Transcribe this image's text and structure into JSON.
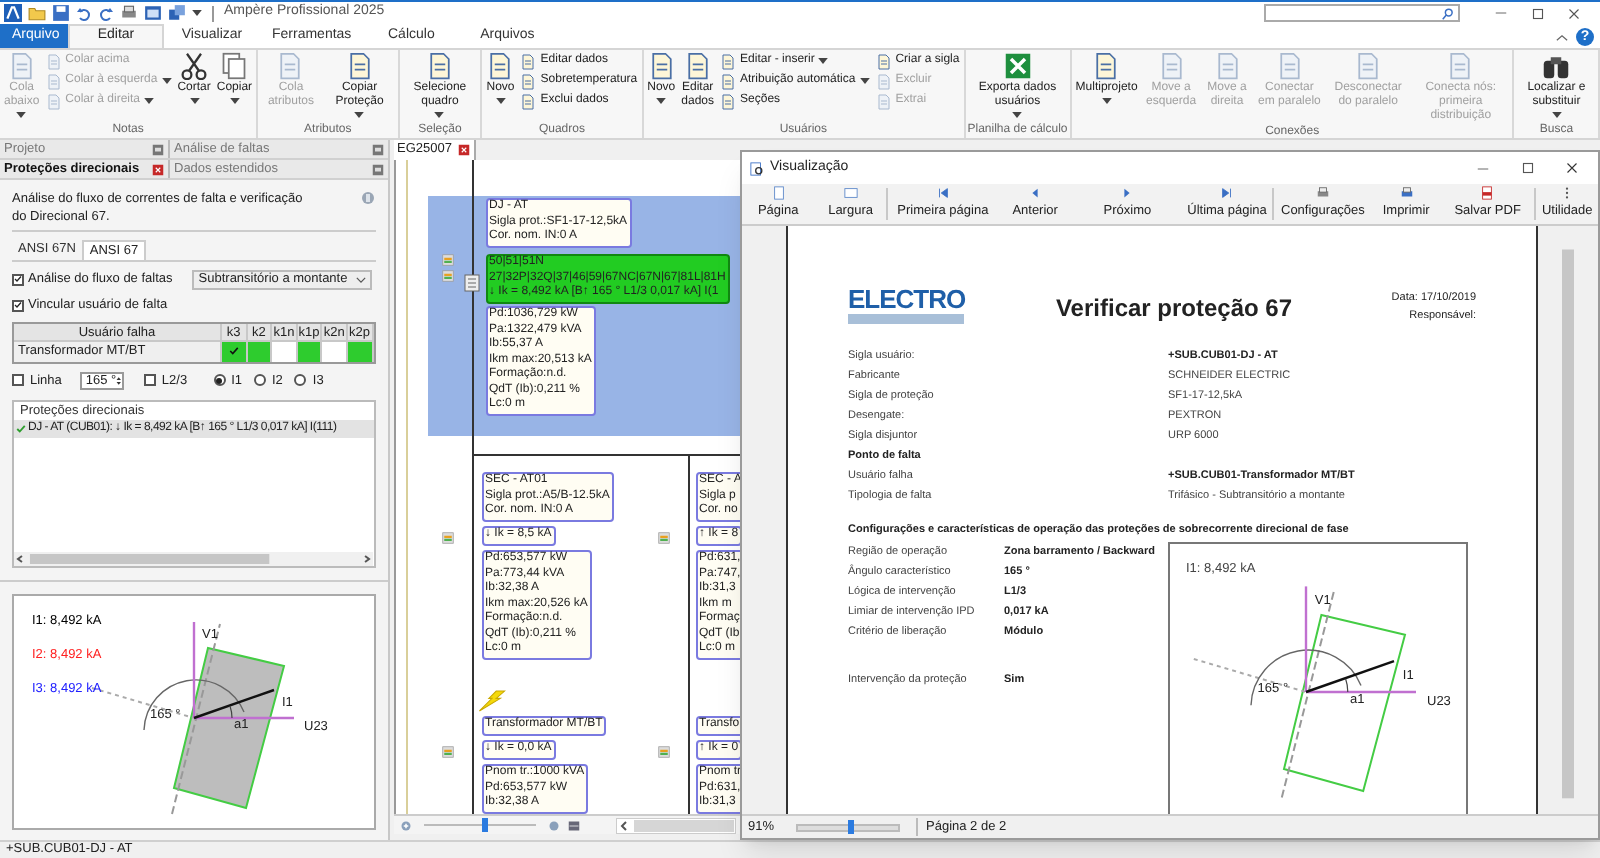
{
  "app": {
    "title": "Ampère Profissional 2025",
    "help": "?"
  },
  "ribbon_tabs": [
    {
      "label": "Arquivo",
      "kind": "file",
      "selected": false
    },
    {
      "label": "Editar",
      "kind": "tab",
      "selected": true
    },
    {
      "label": "Visualizar",
      "kind": "tab",
      "selected": false
    },
    {
      "label": "Ferramentas",
      "kind": "tab",
      "selected": false
    },
    {
      "label": "Cálculo",
      "kind": "tab",
      "selected": false
    },
    {
      "label": "Arquivos",
      "kind": "tab",
      "selected": false
    }
  ],
  "ribbon_groups": [
    {
      "label": "Notas",
      "items": [
        {
          "kind": "large",
          "label": "Cola abaixo",
          "disabled": true,
          "dropdown": true
        },
        {
          "kind": "stack",
          "items": [
            {
              "label": "Colar acima",
              "disabled": true,
              "dropdown": false
            },
            {
              "label": "Colar à esquerda",
              "disabled": true,
              "dropdown": true
            },
            {
              "label": "Colar à direita",
              "disabled": true,
              "dropdown": true
            }
          ]
        },
        {
          "kind": "large",
          "label": "Cortar",
          "disabled": false,
          "dropdown": true
        },
        {
          "kind": "large",
          "label": "Copiar",
          "disabled": false,
          "dropdown": true
        }
      ]
    },
    {
      "label": "Atributos",
      "items": [
        {
          "kind": "large",
          "label": "Cola atributos",
          "disabled": true,
          "dropdown": false
        },
        {
          "kind": "large",
          "label": "Copiar Proteção",
          "disabled": false,
          "dropdown": true
        }
      ]
    },
    {
      "label": "Seleção",
      "items": [
        {
          "kind": "large",
          "label": "Selecione quadro",
          "disabled": false,
          "dropdown": true
        }
      ]
    },
    {
      "label": "Quadros",
      "items": [
        {
          "kind": "large",
          "label": "Novo",
          "disabled": false,
          "dropdown": true
        },
        {
          "kind": "stack",
          "items": [
            {
              "label": "Editar dados",
              "disabled": false,
              "dropdown": false
            },
            {
              "label": "Sobretemperatura",
              "disabled": false,
              "dropdown": false
            },
            {
              "label": "Exclui dados",
              "disabled": false,
              "dropdown": false
            }
          ]
        }
      ]
    },
    {
      "label": "Usuários",
      "items": [
        {
          "kind": "large",
          "label": "Novo",
          "disabled": false,
          "dropdown": true
        },
        {
          "kind": "large",
          "label": "Editar dados",
          "disabled": false,
          "dropdown": false
        },
        {
          "kind": "stack",
          "items": [
            {
              "label": "Editar - inserir",
              "disabled": false,
              "dropdown": true
            },
            {
              "label": "Atribuição automática",
              "disabled": false,
              "dropdown": true
            },
            {
              "label": "Seções",
              "disabled": false,
              "dropdown": false
            }
          ]
        },
        {
          "kind": "stack",
          "items": [
            {
              "label": "Criar a sigla",
              "disabled": false,
              "dropdown": false
            },
            {
              "label": "Excluir",
              "disabled": true,
              "dropdown": false
            },
            {
              "label": "Extrai",
              "disabled": true,
              "dropdown": false
            }
          ]
        }
      ]
    },
    {
      "label": "Planilha de cálculo",
      "items": [
        {
          "kind": "large",
          "label": "Exporta dados usuários",
          "disabled": false,
          "dropdown": true
        }
      ]
    },
    {
      "label": "Conexões",
      "items": [
        {
          "kind": "large",
          "label": "Multiprojeto",
          "disabled": false,
          "dropdown": true
        },
        {
          "kind": "large",
          "label": "Move a esquerda",
          "disabled": true,
          "dropdown": false
        },
        {
          "kind": "large",
          "label": "Move a direita",
          "disabled": true,
          "dropdown": false
        },
        {
          "kind": "large",
          "label": "Conectar em paralelo",
          "disabled": true,
          "dropdown": false
        },
        {
          "kind": "large",
          "label": "Desconectar do paralelo",
          "disabled": true,
          "dropdown": false
        },
        {
          "kind": "large",
          "label": "Conecta nós: primeira distribuição",
          "disabled": true,
          "dropdown": false
        }
      ]
    },
    {
      "label": "Busca",
      "items": [
        {
          "kind": "large",
          "label": "Localizar e substituir",
          "disabled": false,
          "dropdown": true
        }
      ]
    }
  ],
  "left_panel": {
    "panel_tabs": [
      {
        "label": "Projeto",
        "selected": false
      },
      {
        "label": "Análise de faltas",
        "selected": false
      },
      {
        "label": "Proteções direcionais",
        "selected": true
      },
      {
        "label": "Dados estendidos",
        "selected": false
      }
    ],
    "description": "Análise do fluxo de correntes de falta e verificação do Direcional 67.",
    "ansi_tabs": [
      {
        "label": "ANSI 67N",
        "selected": false
      },
      {
        "label": "ANSI 67",
        "selected": true
      }
    ],
    "options": [
      {
        "label": "Análise do fluxo de faltas",
        "checked": true
      },
      {
        "label": "Vincular usuário de falta",
        "checked": true
      }
    ],
    "fault_type": {
      "value": "Subtransitório a montante"
    },
    "fault_table": {
      "columns": [
        "Usuário falha",
        "k3",
        "k2",
        "k1n",
        "k1p",
        "k2n",
        "k2p"
      ],
      "rows": [
        {
          "user": "Transformador MT/BT",
          "cells": [
            {
              "on": true,
              "checked": true
            },
            {
              "on": true,
              "checked": false
            },
            {
              "on": false,
              "checked": false
            },
            {
              "on": true,
              "checked": false
            },
            {
              "on": false,
              "checked": false
            },
            {
              "on": true,
              "checked": false
            }
          ]
        }
      ]
    },
    "line_option": {
      "label": "Linha",
      "checked": false
    },
    "angle": {
      "value": "165 °"
    },
    "l23_option": {
      "label": "L2/3",
      "checked": false
    },
    "current_choice": [
      {
        "label": "I1",
        "selected": true
      },
      {
        "label": "I2",
        "selected": false
      },
      {
        "label": "I3",
        "selected": false
      }
    ],
    "protections": {
      "title": "Proteções direcionais",
      "items": [
        {
          "label": "DJ - AT (CUB01): ↓ Ik = 8,492 kA [B↑ 165 ° L1/3 0,017 kA] I(111)",
          "verified": true
        }
      ]
    },
    "phasor": {
      "currents": [
        {
          "label": "I1: 8,492 kA",
          "color": "#000000"
        },
        {
          "label": "I2: 8,492 kA",
          "color": "#ff2020"
        },
        {
          "label": "I3: 8,492 kA",
          "color": "#2020ff"
        }
      ],
      "v1": "V1",
      "i1": "I1",
      "u23": "U23",
      "angle": "165 °",
      "a1": "a1"
    }
  },
  "diagram": {
    "tab": "EG25007",
    "main": {
      "breaker": [
        "DJ - AT",
        "Sigla prot.:SF1-17-12,5kA",
        "Cor. nom. IN:0 A"
      ],
      "protection": [
        "50|51|51N",
        "27|32P|32Q|37|46|59|67NC|67N|67|81L|81H",
        "↓ Ik = 8,492 kA [B↑ 165 ° L1/3 0,017 kA] I(1"
      ],
      "results": [
        "Pd:1036,729 kW",
        "Pa:1322,479 kVA",
        "Ib:55,37 A",
        "Ikm max:20,513 kA",
        "Formação:n.d.",
        "QdT (Ib):0,211 %",
        "Lc:0 m"
      ]
    },
    "branches": [
      {
        "breaker": [
          "SEC - AT01",
          "Sigla prot.:A5/B-12.5kA",
          "Cor. nom. IN:0 A"
        ],
        "fault": "↓ Ik = 8,5 kA",
        "results": [
          "Pd:653,577 kW",
          "Pa:773,44 kVA",
          "Ib:32,38 A",
          "Ikm max:20,526 kA",
          "Formação:n.d.",
          "QdT (Ib):0,211 %",
          "Lc:0 m"
        ],
        "fault_marker": true,
        "transformer": "Transformador MT/BT",
        "transformer_fault": "↓ Ik = 0,0 kA",
        "transformer_results": [
          "Pnom tr.:1000 kVA",
          "Pd:653,577 kW",
          "Ib:32,38 A"
        ]
      },
      {
        "breaker": [
          "SEC - A",
          "Sigla p",
          "Cor. no"
        ],
        "fault": "↑ Ik = 8",
        "results": [
          "Pd:631,",
          "Pa:747,",
          "Ib:31,3",
          "Ikm m",
          "Formaç",
          "QdT (Ib",
          "Lc:0 m"
        ],
        "fault_marker": false,
        "transformer": "Transfo",
        "transformer_fault": "↑ Ik = 0",
        "transformer_results": [
          "Pnom tr",
          "Pd:631,",
          "Ib:31,3"
        ]
      }
    ],
    "zoom_slider": {
      "level": 0.55
    }
  },
  "preview": {
    "title": "Visualização",
    "toolbar": [
      "Página",
      "Largura",
      "Primeira página",
      "Anterior",
      "Próximo",
      "Última página",
      "Configurações",
      "Imprimir",
      "Salvar PDF",
      "Utilidade"
    ],
    "report": {
      "logo": "ELECTRO",
      "title": "Verificar proteção 67",
      "date": "Data: 17/10/2019",
      "responsible": "Responsável:",
      "fields": [
        {
          "kind": "field",
          "label": "Sigla usuário:",
          "value": "+SUB.CUB01-DJ - AT",
          "emphasis": true
        },
        {
          "kind": "field",
          "label": "Fabricante",
          "value": "SCHNEIDER ELECTRIC",
          "emphasis": false
        },
        {
          "kind": "field",
          "label": "Sigla de proteção",
          "value": "SF1-17-12,5kA",
          "emphasis": false
        },
        {
          "kind": "field",
          "label": "Desengate:",
          "value": "PEXTRON",
          "emphasis": false
        },
        {
          "kind": "field",
          "label": "Sigla disjuntor",
          "value": "URP 6000",
          "emphasis": false
        },
        {
          "kind": "heading",
          "label": "Ponto de falta"
        },
        {
          "kind": "field",
          "label": "Usuário falha",
          "value": "+SUB.CUB01-Transformador MT/BT",
          "emphasis": true
        },
        {
          "kind": "field",
          "label": "Tipologia de falta",
          "value": "Trifásico - Subtransitório a montante",
          "emphasis": false
        }
      ],
      "section_title": "Configurações e características de operação das proteções de sobrecorrente direcional de fase",
      "settings": [
        {
          "label": "Região de operação",
          "value": "Zona barramento / Backward"
        },
        {
          "label": "Ângulo característico",
          "value": "165 °"
        },
        {
          "label": "Lógica de intervenção",
          "value": "L1/3"
        },
        {
          "label": "Limiar de intervenção IPD",
          "value": "0,017 kA"
        },
        {
          "label": "Critério de liberação",
          "value": "Módulo"
        },
        {
          "label": "Intervenção da proteção",
          "value": "Sim"
        }
      ],
      "phasor": {
        "currents": [
          {
            "label": "I1: 8,492 kA"
          }
        ],
        "v1": "V1",
        "i1": "I1",
        "u23": "U23",
        "angle": "165 °",
        "a1": "a1"
      }
    },
    "zoom": "91%",
    "zoom_slider": {
      "level": 0.5
    },
    "page": "Página 2 de 2"
  },
  "status_bar": "+SUB.CUB01-DJ - AT"
}
